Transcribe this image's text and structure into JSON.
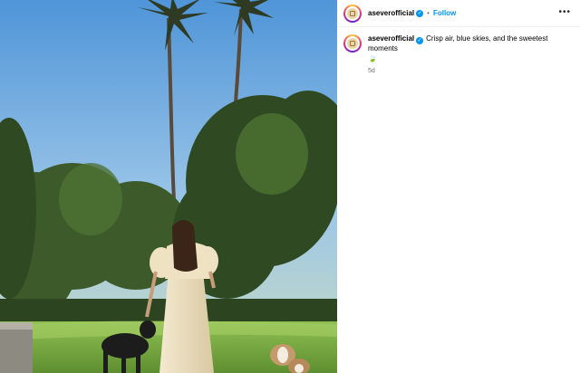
{
  "post": {
    "username": "aseverofficial",
    "verified_mark": "✓",
    "separator": "•",
    "follow_label": "Follow",
    "more_label": "•••",
    "caption": {
      "username": "aseverofficial",
      "text": "Crisp air, blue skies, and the sweetest moments",
      "emoji": "🍃",
      "timestamp": "5d"
    },
    "photo": {
      "description_icon": "photo-image"
    }
  },
  "colors": {
    "accent": "#0095f6",
    "muted_text": "#737373",
    "sky": "#7fb3e0",
    "grass": "#7fae47"
  }
}
